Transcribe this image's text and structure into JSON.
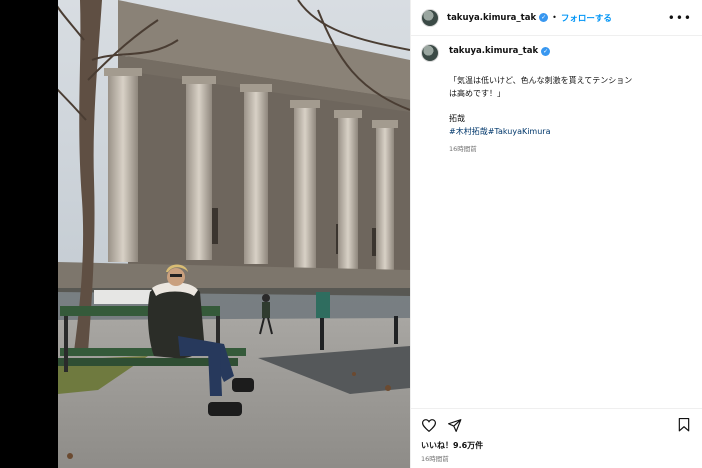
{
  "post": {
    "username": "takuya.kimura_tak",
    "follow_label": "フォローする",
    "separator": "•",
    "more_label": "•••",
    "caption_line": "「気温は低いけど、色んな刺激を貰えてテンションは高めです！」",
    "signature": "拓哉",
    "hashtags": [
      "#木村拓哉",
      "#TakuyaKimura"
    ],
    "caption_time": "16時間前",
    "likes": "いいね！9.6万件",
    "posted_time": "16時間前"
  },
  "icons": {
    "verified": "verified-badge-icon",
    "like": "heart-icon",
    "share": "send-icon",
    "save": "bookmark-icon",
    "more": "more-options-icon"
  },
  "colors": {
    "link_blue": "#0095f6",
    "hashtag": "#00376b",
    "verified": "#3897f0"
  }
}
